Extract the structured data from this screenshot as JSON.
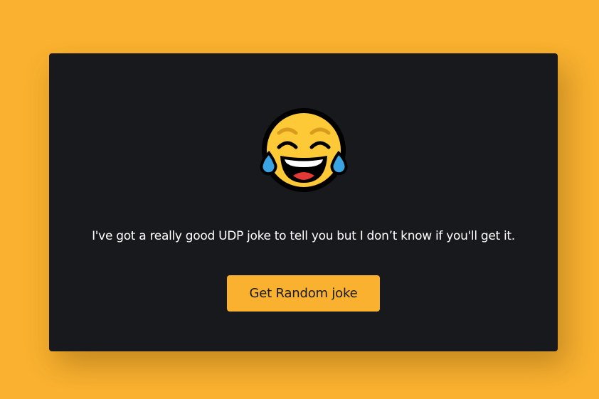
{
  "card": {
    "emoji": "face-with-tears-of-joy-icon",
    "joke_text": "I've got a really good UDP joke to tell you but I don’t know if you'll get it.",
    "button_label": "Get Random joke"
  },
  "colors": {
    "background": "#f9b12f",
    "card": "#18191c",
    "button": "#f9b12f",
    "text": "#ffffff"
  }
}
